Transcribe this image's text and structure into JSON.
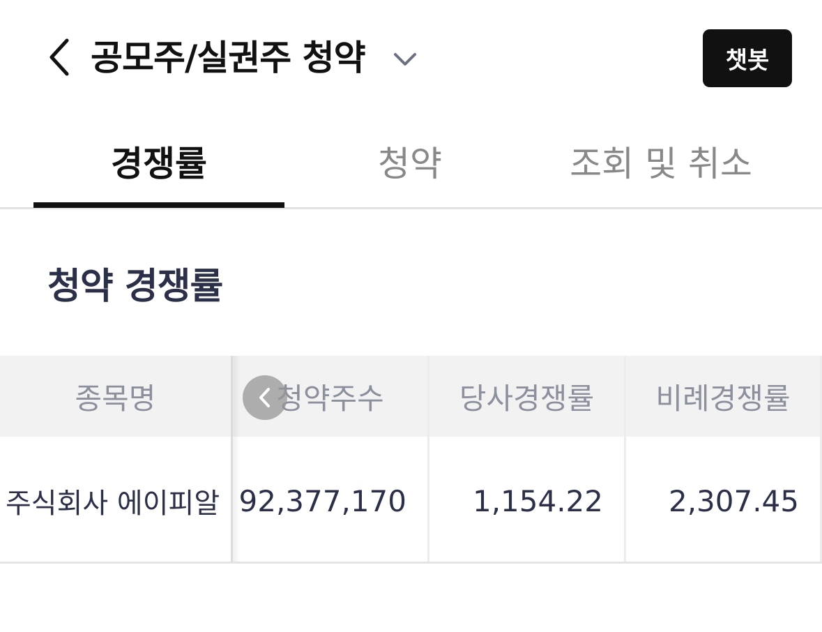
{
  "header": {
    "title": "공모주/실권주 청약",
    "chatbot_label": "챗봇",
    "back_icon": "chevron-left-icon",
    "dropdown_icon": "chevron-down-icon"
  },
  "tabs": [
    {
      "label": "경쟁률",
      "active": true
    },
    {
      "label": "청약",
      "active": false
    },
    {
      "label": "조회 및 취소",
      "active": false
    }
  ],
  "section": {
    "title": "청약 경쟁률"
  },
  "table": {
    "columns": [
      "종목명",
      "청약주수",
      "당사경쟁률",
      "비례경쟁률"
    ],
    "rows": [
      {
        "name": "주식회사 에이피알",
        "shares": "92,377,170",
        "company_rate": "1,154.22",
        "proportional_rate": "2,307.45"
      }
    ]
  },
  "colors": {
    "accent": "#111111",
    "section_title": "#2b3048",
    "header_text": "#8b909c",
    "header_bg": "#f2f2f2"
  }
}
